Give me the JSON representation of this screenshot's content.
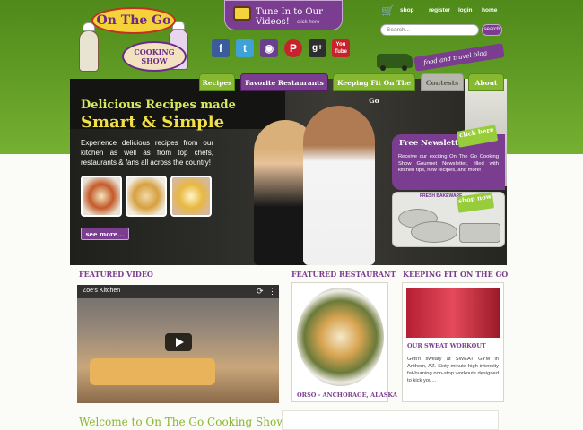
{
  "header": {
    "logo": {
      "title": "On The Go",
      "subtitle_line1": "COOKING",
      "subtitle_line2": "SHOW"
    },
    "tune_in": {
      "title": "Tune In to Our Videos!",
      "subtitle": "click here"
    },
    "top_links": [
      "shop",
      "register",
      "login",
      "home"
    ],
    "search": {
      "placeholder": "Search...",
      "button": "search"
    },
    "social": [
      "facebook",
      "twitter",
      "instagram",
      "pinterest",
      "google-plus",
      "youtube"
    ],
    "social_labels": {
      "googleplus": "g+",
      "youtube": "You Tube"
    },
    "blog_tag": "food and travel blog"
  },
  "nav": {
    "tabs": [
      "Recipes",
      "Favorite Restaurants",
      "Keeping Fit On The Go",
      "Contests",
      "About"
    ]
  },
  "hero": {
    "heading1": "Delicious Recipes made",
    "heading2": "Smart & Simple",
    "text": "Experience delicious recipes from our kitchen as well as from top chefs, restaurants & fans all across the country!",
    "see_more": "see more...",
    "newsletter": {
      "title": "Free Newsletter",
      "click": "click here",
      "text": "Receive our exciting On The Go Cooking Show Gourmet Newsletter, filled with kitchen tips, new recipes, and more!"
    },
    "shop": {
      "label": "shop now",
      "promo": "FRESH BAKEWARE"
    }
  },
  "sections": {
    "featured_video": {
      "title": "FEATURED VIDEO",
      "video_title": "Zoe's Kitchen"
    },
    "featured_restaurant": {
      "title": "FEATURED RESTAURANT",
      "caption": "ORSO - ANCHORAGE, ALASKA"
    },
    "keeping_fit": {
      "title": "KEEPING FIT ON THE GO",
      "subtitle": "OUR SWEAT WORKOUT",
      "text": "Gett'n sweaty at SWEAT GYM in Anthem, AZ. Sixty minute high intensity fat-burning non-stop workouts designed to kick you..."
    }
  },
  "welcome": "Welcome to On The Go Cooking Show",
  "colors": {
    "purple": "#7a3d8f",
    "green": "#76b031",
    "lime_text": "#d8e860"
  }
}
